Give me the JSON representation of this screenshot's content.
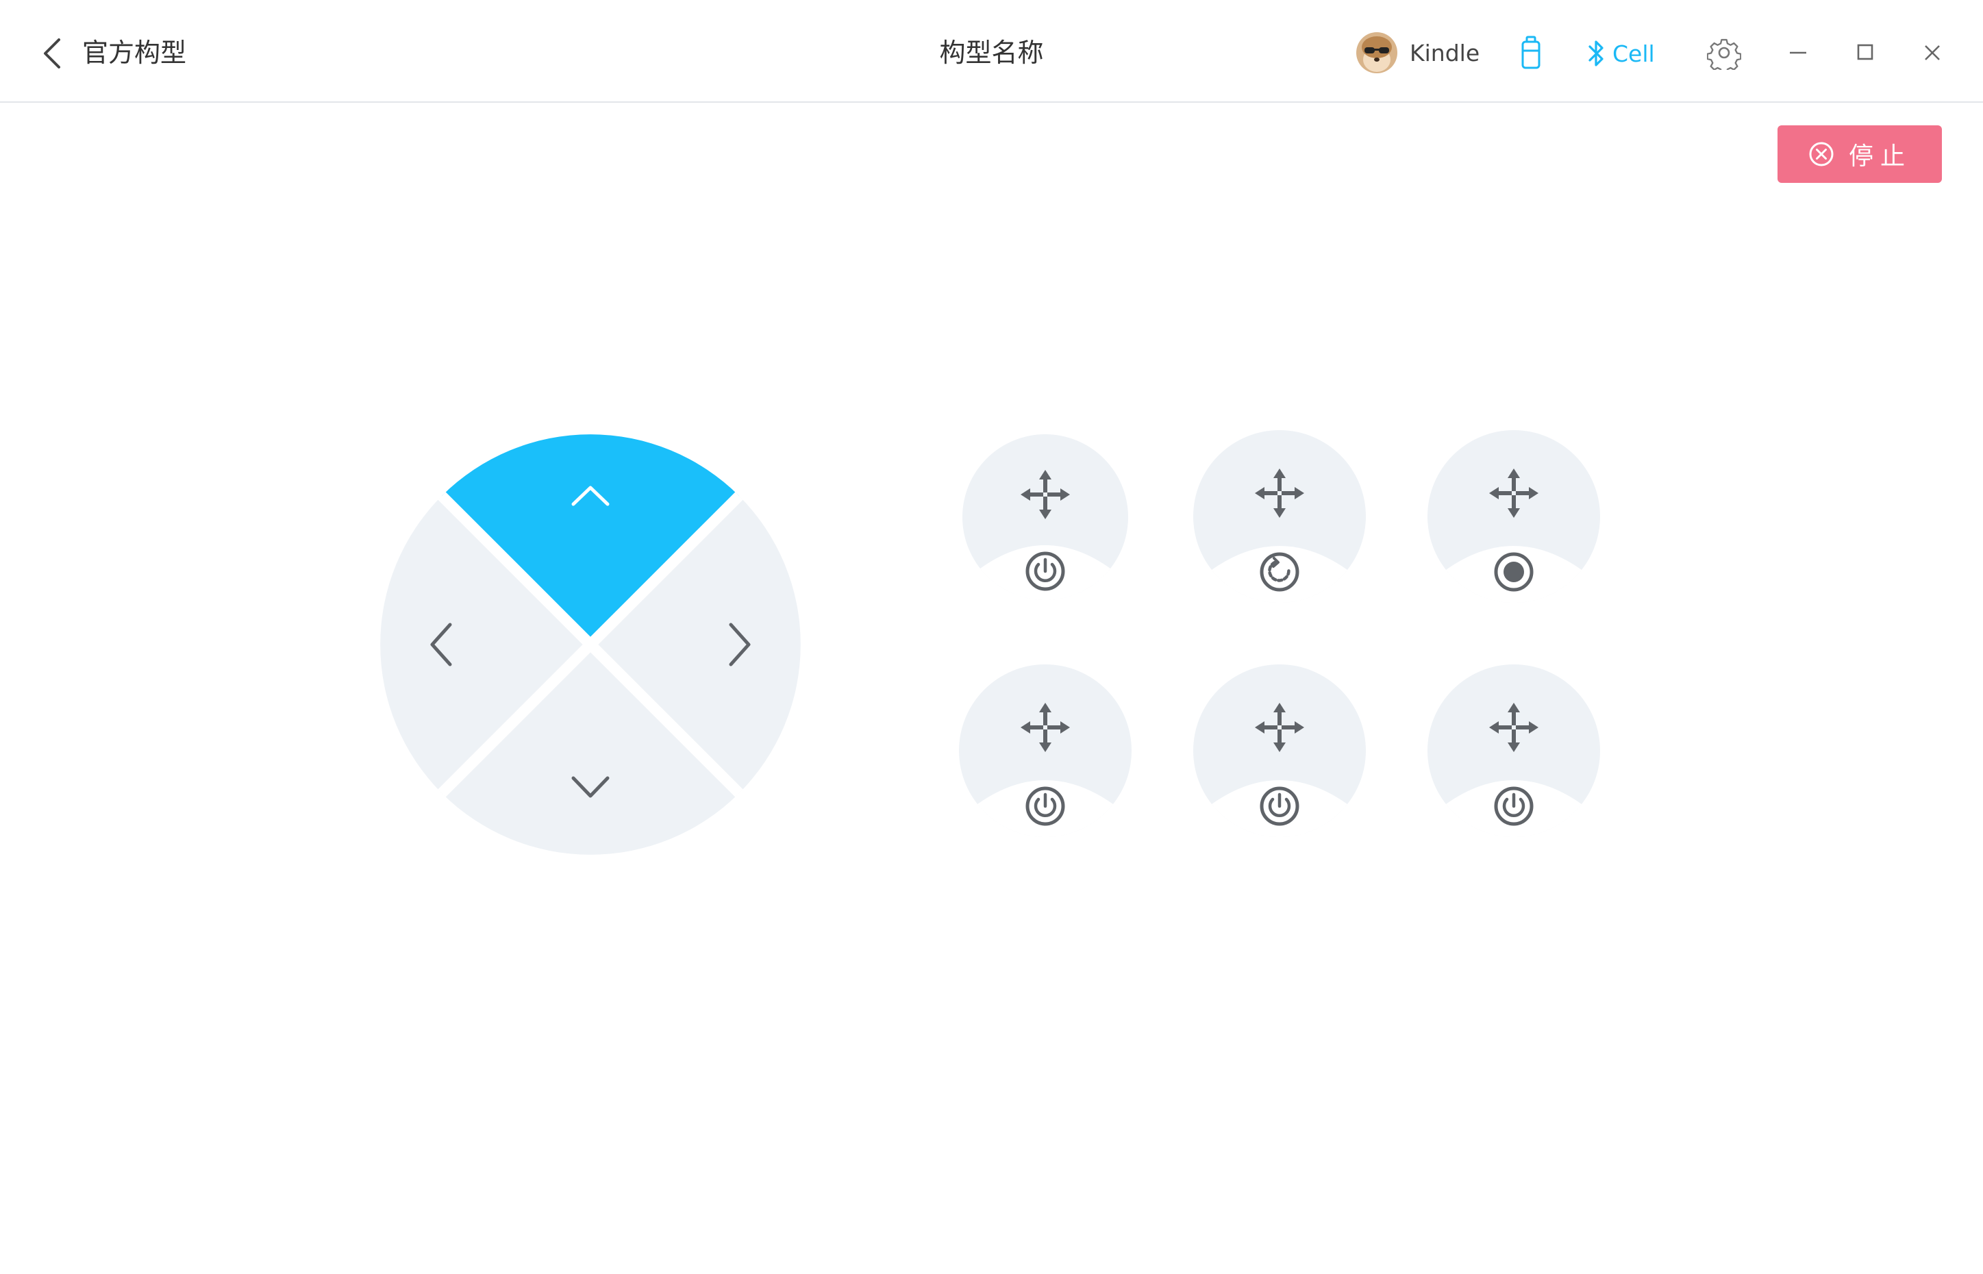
{
  "header": {
    "back_label": "官方构型",
    "title": "构型名称",
    "user_name": "Kindle",
    "bluetooth_label": "Cell"
  },
  "stop_button": {
    "label": "停止"
  },
  "colors": {
    "accent": "#1AB8F5",
    "stop": "#F2718A",
    "pad": "#EEF2F6",
    "icon": "#5F6368"
  },
  "dpad": {
    "active_direction": "up",
    "directions": [
      "up",
      "down",
      "left",
      "right"
    ]
  },
  "function_buttons": [
    {
      "move_icon": "move-arrows-icon",
      "action_icon": "power-icon"
    },
    {
      "move_icon": "move-arrows-icon",
      "action_icon": "rotate-icon"
    },
    {
      "move_icon": "move-arrows-icon",
      "action_icon": "record-icon"
    },
    {
      "move_icon": "move-arrows-icon",
      "action_icon": "power-icon"
    },
    {
      "move_icon": "move-arrows-icon",
      "action_icon": "power-icon"
    },
    {
      "move_icon": "move-arrows-icon",
      "action_icon": "power-icon"
    }
  ]
}
